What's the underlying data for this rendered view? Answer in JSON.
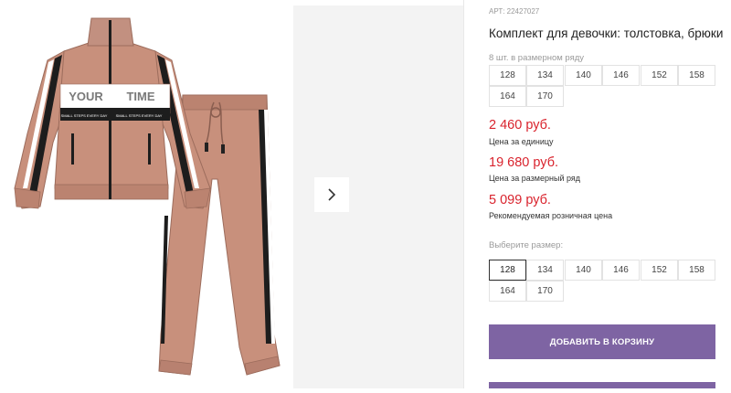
{
  "product": {
    "sku": "АРТ: 22427027",
    "title": "Комплект для девочки: толстовка, брюки"
  },
  "size_row": {
    "label": "8 шт. в размерном ряду",
    "sizes": [
      "128",
      "134",
      "140",
      "146",
      "152",
      "158",
      "164",
      "170"
    ]
  },
  "prices": [
    {
      "value": "2 460 руб.",
      "note": "Цена за единицу"
    },
    {
      "value": "19 680 руб.",
      "note": "Цена за размерный ряд"
    },
    {
      "value": "5 099 руб.",
      "note": "Рекомендуемая розничная цена"
    }
  ],
  "size_select": {
    "label": "Выберите размер:",
    "sizes": [
      "128",
      "134",
      "140",
      "146",
      "152",
      "158",
      "164",
      "170"
    ],
    "selected": "128"
  },
  "image_text": {
    "jacket_word_1": "YOUR",
    "jacket_word_2": "TIME",
    "jacket_slogan_left": "SMALL STEPS EVERY DAY",
    "jacket_slogan_right": "SMALL STEPS EVERY DAY"
  },
  "actions": {
    "add_to_cart": "ДОБАВИТЬ В КОРЗИНУ"
  },
  "colors": {
    "accent": "#7e64a3",
    "price": "#d9232d",
    "fabric": "#c8907c"
  },
  "icons": {
    "next": "chevron-right-icon"
  }
}
